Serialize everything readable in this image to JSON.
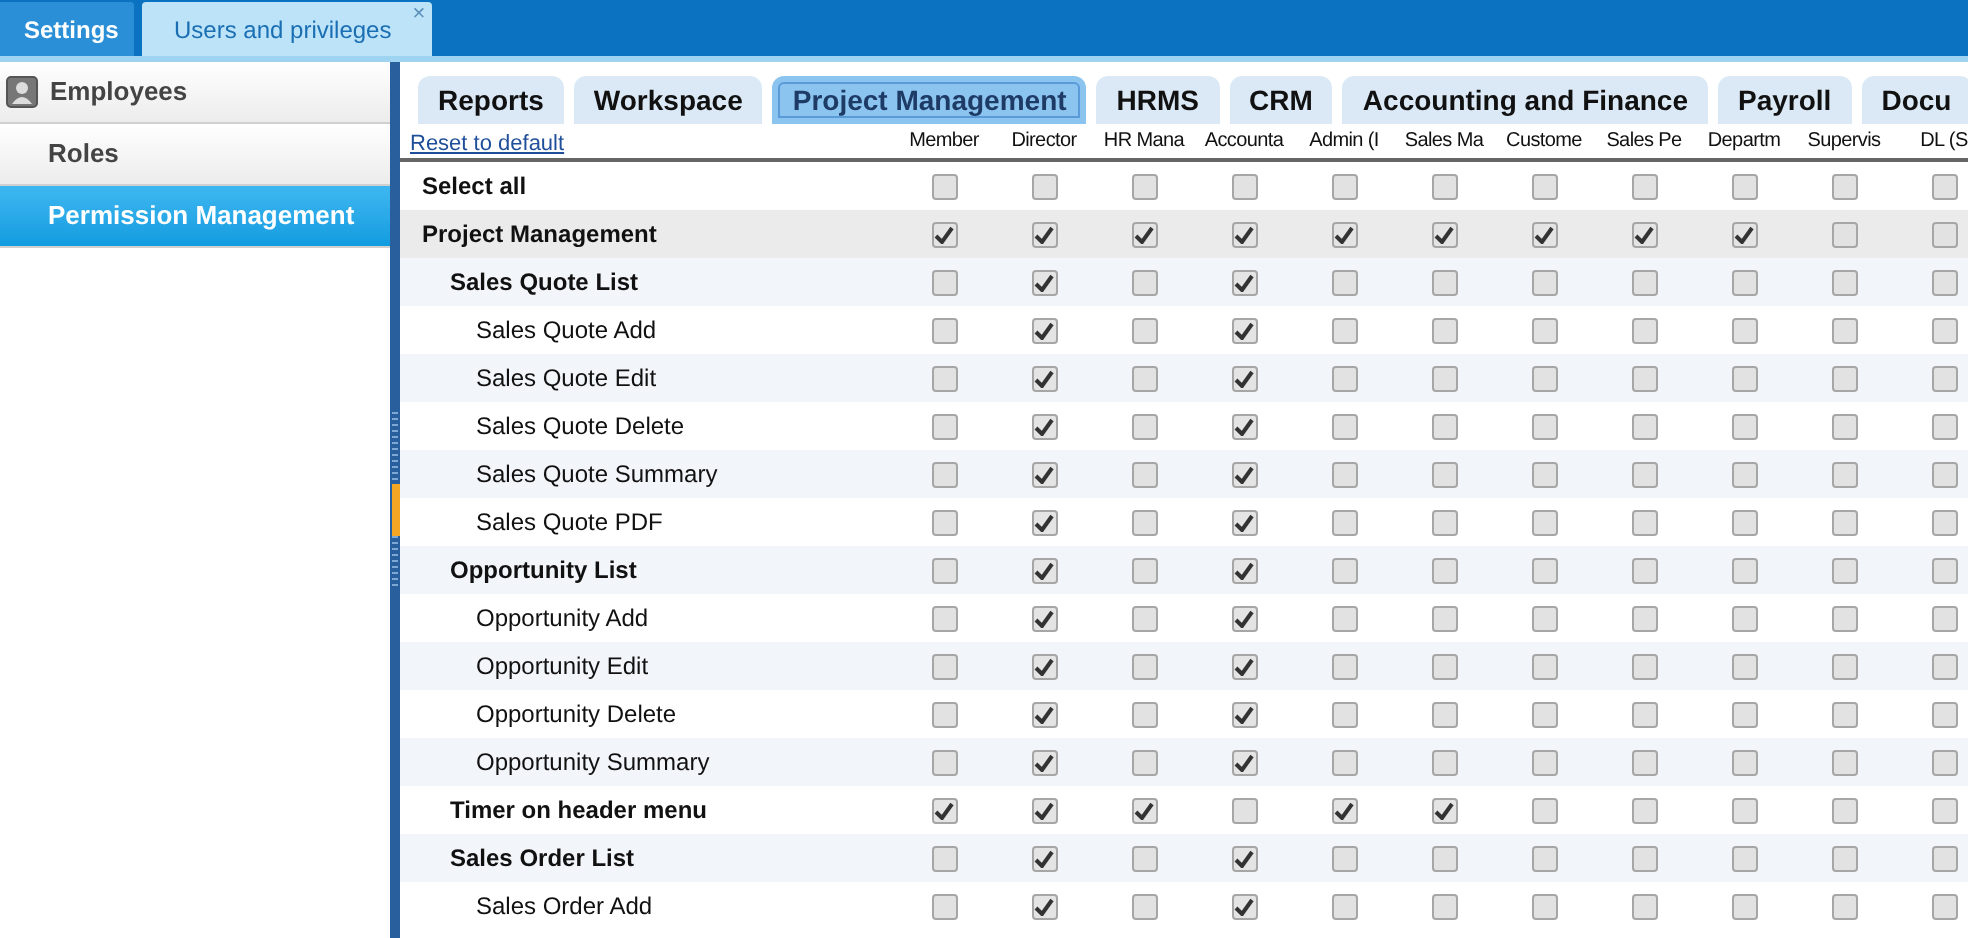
{
  "window_tabs": [
    {
      "label": "Settings",
      "selected": false
    },
    {
      "label": "Users and privileges",
      "selected": true,
      "close": "×"
    }
  ],
  "sidebar": {
    "items": [
      {
        "label": "Employees",
        "kind": "group",
        "selected": false
      },
      {
        "label": "Roles",
        "kind": "item",
        "selected": false
      },
      {
        "label": "Permission Management",
        "kind": "item",
        "selected": true
      }
    ]
  },
  "module_tabs": [
    {
      "label": "Reports",
      "selected": false
    },
    {
      "label": "Workspace",
      "selected": false
    },
    {
      "label": "Project Management",
      "selected": true
    },
    {
      "label": "HRMS",
      "selected": false
    },
    {
      "label": "CRM",
      "selected": false
    },
    {
      "label": "Accounting and Finance",
      "selected": false
    },
    {
      "label": "Payroll",
      "selected": false
    },
    {
      "label": "Docu",
      "selected": false
    }
  ],
  "reset_link": "Reset to default",
  "columns": [
    "Member",
    "Director",
    "HR Mana",
    "Accounta",
    "Admin (I",
    "Sales Ma",
    "Custome",
    "Sales Pe",
    "Departm",
    "Supervis",
    "DL (S"
  ],
  "rows": [
    {
      "label": "Select all",
      "checks": [
        false,
        false,
        false,
        false,
        false,
        false,
        false,
        false,
        false,
        false,
        false
      ]
    },
    {
      "label": "Project Management",
      "checks": [
        true,
        true,
        true,
        true,
        true,
        true,
        true,
        true,
        true,
        false,
        false
      ],
      "children": [
        {
          "label": "Sales Quote List",
          "checks": [
            false,
            true,
            false,
            true,
            false,
            false,
            false,
            false,
            false,
            false,
            false
          ],
          "children": [
            {
              "label": "Sales Quote Add",
              "checks": [
                false,
                true,
                false,
                true,
                false,
                false,
                false,
                false,
                false,
                false,
                false
              ]
            },
            {
              "label": "Sales Quote Edit",
              "checks": [
                false,
                true,
                false,
                true,
                false,
                false,
                false,
                false,
                false,
                false,
                false
              ]
            },
            {
              "label": "Sales Quote Delete",
              "checks": [
                false,
                true,
                false,
                true,
                false,
                false,
                false,
                false,
                false,
                false,
                false
              ]
            },
            {
              "label": "Sales Quote Summary",
              "checks": [
                false,
                true,
                false,
                true,
                false,
                false,
                false,
                false,
                false,
                false,
                false
              ]
            },
            {
              "label": "Sales Quote PDF",
              "checks": [
                false,
                true,
                false,
                true,
                false,
                false,
                false,
                false,
                false,
                false,
                false
              ]
            }
          ]
        },
        {
          "label": "Opportunity List",
          "checks": [
            false,
            true,
            false,
            true,
            false,
            false,
            false,
            false,
            false,
            false,
            false
          ],
          "children": [
            {
              "label": "Opportunity Add",
              "checks": [
                false,
                true,
                false,
                true,
                false,
                false,
                false,
                false,
                false,
                false,
                false
              ]
            },
            {
              "label": "Opportunity Edit",
              "checks": [
                false,
                true,
                false,
                true,
                false,
                false,
                false,
                false,
                false,
                false,
                false
              ]
            },
            {
              "label": "Opportunity Delete",
              "checks": [
                false,
                true,
                false,
                true,
                false,
                false,
                false,
                false,
                false,
                false,
                false
              ]
            },
            {
              "label": "Opportunity Summary",
              "checks": [
                false,
                true,
                false,
                true,
                false,
                false,
                false,
                false,
                false,
                false,
                false
              ]
            }
          ]
        },
        {
          "label": "Timer on header menu",
          "checks": [
            true,
            true,
            true,
            false,
            true,
            true,
            false,
            false,
            false,
            false,
            false
          ]
        },
        {
          "label": "Sales Order List",
          "checks": [
            false,
            true,
            false,
            true,
            false,
            false,
            false,
            false,
            false,
            false,
            false
          ],
          "children": [
            {
              "label": "Sales Order Add",
              "checks": [
                false,
                true,
                false,
                true,
                false,
                false,
                false,
                false,
                false,
                false,
                false
              ]
            }
          ]
        }
      ]
    }
  ]
}
